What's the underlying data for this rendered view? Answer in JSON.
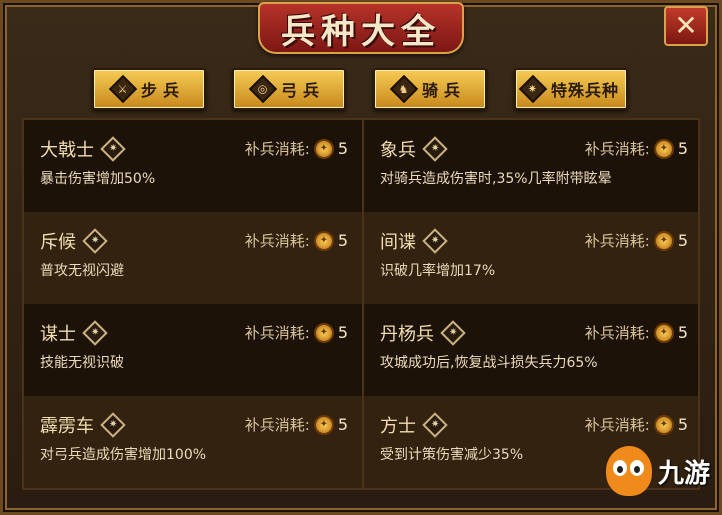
{
  "title": "兵种大全",
  "close_label": "✕",
  "tabs": [
    {
      "label": "步兵",
      "icon": "sword-icon"
    },
    {
      "label": "弓兵",
      "icon": "bow-icon"
    },
    {
      "label": "骑兵",
      "icon": "horse-icon"
    },
    {
      "label": "特殊兵种",
      "icon": "star-icon"
    }
  ],
  "cost_label": "补兵消耗:",
  "units": [
    {
      "name": "大戟士",
      "cost": "5",
      "desc": "暴击伤害增加50%"
    },
    {
      "name": "象兵",
      "cost": "5",
      "desc": "对骑兵造成伤害时,35%几率附带眩晕"
    },
    {
      "name": "斥候",
      "cost": "5",
      "desc": "普攻无视闪避"
    },
    {
      "name": "间谍",
      "cost": "5",
      "desc": "识破几率增加17%"
    },
    {
      "name": "谋士",
      "cost": "5",
      "desc": "技能无视识破"
    },
    {
      "name": "丹杨兵",
      "cost": "5",
      "desc": "攻城成功后,恢复战斗损失兵力65%"
    },
    {
      "name": "霹雳车",
      "cost": "5",
      "desc": "对弓兵造成伤害增加100%"
    },
    {
      "name": "方士",
      "cost": "5",
      "desc": "受到计策伤害减少35%"
    }
  ],
  "watermark": {
    "text": "九游",
    "icon": "jiuyou-logo-icon"
  },
  "colors": {
    "accent": "#c7881c",
    "banner": "#b8342a"
  }
}
